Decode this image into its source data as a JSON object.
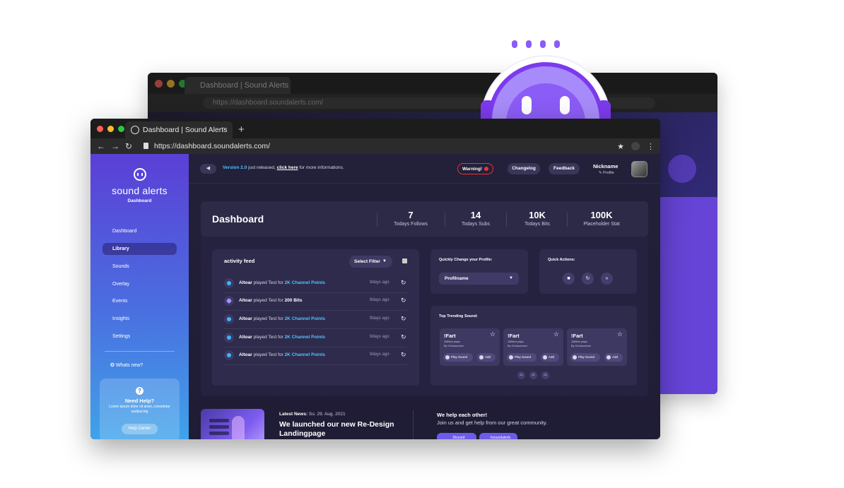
{
  "browser": {
    "tab_title": "Dashboard | Sound Alerts",
    "tab_close": "×",
    "new_tab": "+",
    "url": "https://dashboard.soundalerts.com/",
    "back_tab_title": "Dashboard | Sound Alerts",
    "back_url": "https://dashboard.soundalerts.com/"
  },
  "sidebar": {
    "logo_text": "sound alerts",
    "logo_sub": "Dashboard",
    "items": [
      {
        "label": "Dashboard"
      },
      {
        "label": "Library"
      },
      {
        "label": "Sounds"
      },
      {
        "label": "Overlay"
      },
      {
        "label": "Events"
      },
      {
        "label": "Insights"
      },
      {
        "label": "Settings"
      }
    ],
    "whats_new": "Whats new?",
    "help": {
      "title": "Need Help?",
      "text": "Lorem ipsum dolor sit amet, consetetur sadipscing",
      "button": "Help Center"
    }
  },
  "topbar": {
    "version": "Version 2.0",
    "announce_mid": " just released, ",
    "announce_link": "click here",
    "announce_end": " for more informations.",
    "warning": "Warning!",
    "changelog": "Changelog",
    "feedback": "Feedback",
    "nickname": "Nickname",
    "profile": "✎ Profile"
  },
  "dashboard": {
    "title": "Dashboard",
    "stats": [
      {
        "value": "7",
        "label": "Todays Follows"
      },
      {
        "value": "14",
        "label": "Todays Subs"
      },
      {
        "value": "10K",
        "label": "Todays Bits"
      },
      {
        "value": "100K",
        "label": "Placeholder Stat"
      }
    ]
  },
  "feed": {
    "title": "activity feed",
    "filter": "Select Filter",
    "rows": [
      {
        "user": "Altoar",
        "mid": " played Test for ",
        "amount": "2K Channel Points",
        "time": "9days ago",
        "type": "points"
      },
      {
        "user": "Altoar",
        "mid": " played Test for ",
        "amount": "200 Bits",
        "time": "9days ago",
        "type": "bits"
      },
      {
        "user": "Altoar",
        "mid": " played Test for ",
        "amount": "2K Channel Points",
        "time": "9days ago",
        "type": "points"
      },
      {
        "user": "Altoar",
        "mid": " played Test for ",
        "amount": "2K Channel Points",
        "time": "9days ago",
        "type": "points"
      },
      {
        "user": "Altoar",
        "mid": " played Test for ",
        "amount": "2K Channel Points",
        "time": "9days ago",
        "type": "points"
      }
    ]
  },
  "profile_switch": {
    "label": "Quickly Change your Profile:",
    "value": "Profilname"
  },
  "quick_actions": {
    "label": "Quick Actions:"
  },
  "trending": {
    "label": "Top Trending Sound:",
    "sounds": [
      {
        "title": "!Fart",
        "plays": "1Million plays",
        "by": "By Chrissommer",
        "play": "Play Sound",
        "add": "Add"
      },
      {
        "title": "!Fart",
        "plays": "1Million plays",
        "by": "By Chrissommer",
        "play": "Play Sound",
        "add": "Add"
      },
      {
        "title": "!Fart",
        "plays": "1Million plays",
        "by": "By Chrissommer",
        "play": "Play Sound",
        "add": "Add"
      }
    ],
    "pages": [
      "01",
      "02",
      "03"
    ]
  },
  "news": {
    "date_label": "Latest News:",
    "date": " So. 29. Aug. 2021",
    "title": "We launched our new Re-Design Landingpage",
    "help_title": "We help each other!",
    "help_sub": "Join us and get help from our great community.",
    "discord": "Discord",
    "twitter": "#soundalerts"
  },
  "colors": {
    "accent": "#4fc3ff",
    "warning": "#ee3333",
    "brand_purple": "#7c3aed"
  }
}
